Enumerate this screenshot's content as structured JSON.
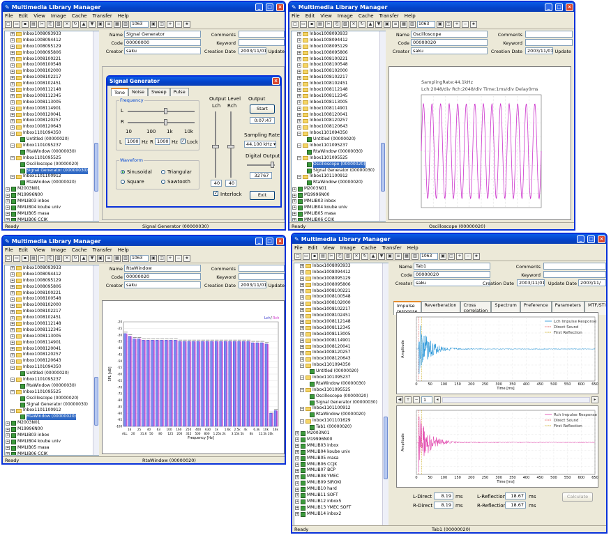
{
  "app_title": "Multimedia Library Manager",
  "menu": [
    "File",
    "Edit",
    "View",
    "Image",
    "Cache",
    "Transfer",
    "Help"
  ],
  "toolbar_select": "1063",
  "window_buttons": {
    "min": "_",
    "max": "□",
    "close": "×"
  },
  "tree_common": [
    "Inbox1008093933",
    "Inbox1008094412",
    "Inbox1008095129",
    "Inbox1008095806",
    "Inbox1008100221",
    "Inbox1008100548",
    "Inbox1008102000",
    "Inbox1008102217",
    "Inbox1008102451",
    "Inbox1008112148",
    "Inbox1008112345",
    "Inbox1008113005",
    "Inbox1008114901",
    "Inbox1008120041",
    "Inbox1008120257",
    "Inbox1008120643",
    "Inbox1101094350",
    "Untitled (00000020)",
    "Inbox1101095237",
    "RtaWindow (00000030)",
    "Inbox1101095525",
    "Oscilloscope (00000020)",
    "Signal Generator (00000030)",
    "Inbox1101100912",
    "RtaWindow (00000020)"
  ],
  "tree_roots_short": [
    "M2003N01",
    "M19996N00",
    "MMLIB03 inbox",
    "MMLIB04 koube univ",
    "MMLIB05 masa",
    "MMLIB06 CCJK"
  ],
  "tree_roots_long": [
    "Inbox1101101629",
    "Tab1 (00000020)",
    "M2003N01",
    "M19996N00",
    "MMLIB03 inbox",
    "MMLIB04 koube univ",
    "MMLIB05 masa",
    "MMLIB06 CCJK",
    "MMLIB07 BCP",
    "MMLIB08 YMEC",
    "MMLIB09 SIROKI",
    "MMLIB10 hard",
    "MMLIB11 SOFT",
    "MMLIB12 inbox5",
    "MMLIB13 YMEC SOFT",
    "MMLIB14 inbox2"
  ],
  "form_labels": {
    "name": "Name",
    "code": "Code",
    "creator": "Creator",
    "comments": "Comments",
    "keyword": "Keyword",
    "creation_date": "Creation Date",
    "update": "Update",
    "update_date": "Update Date"
  },
  "creator_value": "saku",
  "creation_date": "2003/11/01",
  "update_date": "2003/11/",
  "status_ready": "Ready",
  "w1": {
    "name": "Signal Generator",
    "code": "00000000",
    "status": "Signal Generator (00000030)",
    "dialog": {
      "title": "Signal Generator",
      "tabs": [
        "Tone",
        "Noise",
        "Sweep",
        "Pulse"
      ],
      "frequency_label": "Frequency",
      "L": "L",
      "R": "R",
      "scale": [
        "10",
        "100",
        "1k",
        "10k"
      ],
      "l_freq": "1000",
      "r_freq": "1000",
      "hz": "Hz",
      "lock": "Lock",
      "waveform_label": "Waveform",
      "waves": [
        "Sinusoidal",
        "Triangular",
        "Square",
        "Sawtooth"
      ],
      "output_level": "Output Level",
      "lch": "Lch",
      "rch": "Rch",
      "level_l": "40",
      "level_r": "40",
      "interlock": "Interlock",
      "output": "Output",
      "start": "Start",
      "time": "0:07:47",
      "sampling_rate": "Sampling Rate",
      "rate": "44.100 kHz",
      "digital_output": "Digital Output",
      "digital_value": "32767",
      "exit": "Exit"
    }
  },
  "w2": {
    "name": "Oscilloscope",
    "code": "00000020",
    "status": "Oscilloscope (00000020)",
    "text1": "SamplingRate:44.1kHz",
    "text2": "Lch:2048/div  Rch:2048/div  Time:1ms/div  Delay0ms"
  },
  "w3": {
    "name": "RtaWindow",
    "code": "00000020",
    "status": "RtaWindow (00000020)",
    "legend_lch": "Lch",
    "legend_sep": "/",
    "legend_rch": "Rch",
    "chart_data": {
      "type": "bar",
      "ylabel": "SPL [dB]",
      "xlabel": "Frequency [Hz]",
      "ylim": [
        -100,
        -20
      ],
      "yticks": [
        "-20",
        "-25",
        "-30",
        "-35",
        "-40",
        "-45",
        "-50",
        "-55",
        "-60",
        "-65",
        "-70",
        "-75",
        "-80",
        "-85",
        "-90",
        "-95",
        "-100"
      ],
      "categories_top": [
        "16",
        "25",
        "40",
        "63",
        "100",
        "160",
        "250",
        "400",
        "630",
        "1k",
        "1.6k",
        "2.5k",
        "4k",
        "6.3k",
        "10k",
        "16k"
      ],
      "categories_bottom": [
        "ALL",
        "20",
        "31.6",
        "50",
        "80",
        "125",
        "200",
        "315",
        "500",
        "800",
        "1.25k",
        "2k",
        "3.15k",
        "5k",
        "8k",
        "12.5k",
        "20k"
      ],
      "series": [
        {
          "name": "Lch",
          "values": [
            -29,
            -31,
            -33,
            -33,
            -34,
            -34,
            -34,
            -34,
            -34,
            -34,
            -34,
            -34,
            -35,
            -35,
            -35,
            -35,
            -35,
            -35,
            -35,
            -35,
            -35,
            -35,
            -35,
            -35,
            -35,
            -35,
            -35,
            -35,
            -36,
            -36,
            -36,
            -37,
            -90,
            -88
          ]
        }
      ]
    }
  },
  "w4": {
    "name": "Tab1",
    "code": "00000020",
    "status": "Tab1 (00000020)",
    "tabs": [
      "Impulse response",
      "Reverberation",
      "Cross correlation",
      "Spectrum",
      "Preference",
      "Parameters",
      "MTF/STI"
    ],
    "spin_value": "1",
    "chart_data": [
      {
        "type": "line",
        "title": "",
        "ylabel": "Amplitude",
        "xlabel": "Time [ms]",
        "xlim": [
          0,
          650
        ],
        "xticks": [
          0,
          50,
          100,
          150,
          200,
          250,
          300,
          350,
          400,
          450,
          500,
          550,
          600,
          650
        ],
        "legend": [
          "Lch Impulse Response",
          "Direct Sound",
          "First Reflection"
        ]
      },
      {
        "type": "line",
        "title": "",
        "ylabel": "Amplitude",
        "xlabel": "Time [ms]",
        "xlim": [
          0,
          650
        ],
        "xticks": [
          0,
          50,
          100,
          150,
          200,
          250,
          300,
          350,
          400,
          450,
          500,
          550,
          600,
          650
        ],
        "legend": [
          "Rch Impulse Response",
          "Direct Sound",
          "First Reflection"
        ]
      }
    ],
    "l_direct_label": "L-Direct",
    "l_direct": "8.19",
    "r_direct_label": "R-Direct",
    "r_direct": "8.19",
    "l_refl_label": "L-Reflection",
    "l_refl": "18.67",
    "r_refl_label": "R-Reflection",
    "r_refl": "18.67",
    "ms": "ms",
    "calculate": "Calculate"
  },
  "colors": {
    "title": "#0a5ce6",
    "lch": "#3333cc",
    "rch": "#cc33cc",
    "bar": "#7a8cf0",
    "ir_left": "#1a8fd6",
    "ir_right": "#e03aa8"
  }
}
